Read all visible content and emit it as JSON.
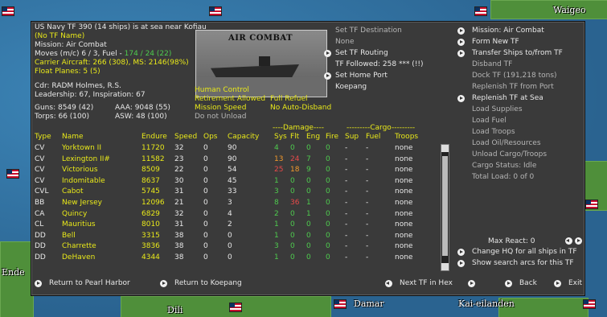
{
  "map": {
    "labels": [
      "Waigeo",
      "Dili",
      "Damar",
      "Kai-eilanden",
      "Ende"
    ]
  },
  "summary": {
    "title": "US Navy TF 390 (14 ships) is at sea near Kofiau",
    "tf_name": "(No TF Name)",
    "mission": "Mission: Air Combat",
    "moves_prefix": "Moves (m/c) 6 / 3, Fuel - ",
    "fuel": "174 / 24 (22)",
    "carrier": "Carrier Aircraft: 266 (308), MS: 2146(98%)",
    "float": "Float Planes: 5 (5)",
    "cdr": "Cdr: RADM Holmes, R.S.",
    "leadership": "Leadership: 67, Inspiration: 67",
    "guns": "Guns: 8549 (42)",
    "aaa": "AAA: 9048 (55)",
    "torps": "Torps: 66 (100)",
    "asw": "ASW: 48 (100)"
  },
  "photo_caption": "AIR COMBAT",
  "orders": {
    "human": "Human Control",
    "retire": "Retirement Allowed",
    "refuel": "Full Refuel",
    "speed": "Mission Speed",
    "disband": "No Auto-Disband",
    "unload": "Do not Unload"
  },
  "dest": {
    "set_dest": "Set TF Destination",
    "none": "None",
    "routing": "Set TF Routing",
    "followed": "TF Followed: 258 *** (!!)",
    "home": "Set Home Port",
    "port": "Koepang"
  },
  "menu": {
    "mission": "Mission: Air Combat",
    "form": "Form New TF",
    "transfer": "Transfer Ships to/from TF",
    "disband": "Disband TF",
    "dock": "Dock TF (191,218 tons)",
    "replenish_port": "Replenish TF from Port",
    "replenish_sea": "Replenish TF at Sea",
    "load_supplies": "Load Supplies",
    "load_fuel": "Load Fuel",
    "load_troops": "Load Troops",
    "load_oil": "Load Oil/Resources",
    "unload": "Unload Cargo/Troops",
    "cargo_status": "Cargo Status: Idle",
    "total_load": "Total Load: 0 of 0",
    "max_react": "Max React: 0",
    "change_hq": "Change HQ for all ships in TF",
    "search_arcs": "Show search arcs for this TF"
  },
  "table": {
    "damage_header": "----Damage----",
    "cargo_header": "---------Cargo---------",
    "columns": [
      "Type",
      "Name",
      "Endure",
      "Speed",
      "Ops",
      "Capacity",
      "Sys",
      "Flt",
      "Eng",
      "Fire",
      "Sup",
      "Fuel",
      "Troops"
    ],
    "rows": [
      {
        "type": "CV",
        "name": "Yorktown II",
        "endure": "11720",
        "speed": "32",
        "ops": "0",
        "cap": "90",
        "sys": "4",
        "flt": "0",
        "eng": "0",
        "fire": "0",
        "sup": "-",
        "fuel": "-",
        "troops": "none",
        "color": "#4ecb4e"
      },
      {
        "type": "CV",
        "name": "Lexington II#",
        "endure": "11582",
        "speed": "23",
        "ops": "0",
        "cap": "90",
        "sys": "13",
        "flt": "24",
        "eng": "7",
        "fire": "0",
        "sup": "-",
        "fuel": "-",
        "troops": "none",
        "color": "#f39a2c"
      },
      {
        "type": "CV",
        "name": "Victorious",
        "endure": "8509",
        "speed": "22",
        "ops": "0",
        "cap": "54",
        "sys": "25",
        "flt": "18",
        "eng": "9",
        "fire": "0",
        "sup": "-",
        "fuel": "-",
        "troops": "none",
        "color": "#f39a2c"
      },
      {
        "type": "CV",
        "name": "Indomitable",
        "endure": "8637",
        "speed": "30",
        "ops": "0",
        "cap": "45",
        "sys": "1",
        "flt": "0",
        "eng": "0",
        "fire": "0",
        "sup": "-",
        "fuel": "-",
        "troops": "none",
        "color": "#4ecb4e"
      },
      {
        "type": "CVL",
        "name": "Cabot",
        "endure": "5745",
        "speed": "31",
        "ops": "0",
        "cap": "33",
        "sys": "3",
        "flt": "0",
        "eng": "0",
        "fire": "0",
        "sup": "-",
        "fuel": "-",
        "troops": "none",
        "color": "#4ecb4e"
      },
      {
        "type": "BB",
        "name": "New Jersey",
        "endure": "12096",
        "speed": "21",
        "ops": "0",
        "cap": "3",
        "sys": "8",
        "flt": "36",
        "eng": "1",
        "fire": "0",
        "sup": "-",
        "fuel": "-",
        "troops": "none",
        "color": "#4ecb4e"
      },
      {
        "type": "CA",
        "name": "Quincy",
        "endure": "6829",
        "speed": "32",
        "ops": "0",
        "cap": "4",
        "sys": "2",
        "flt": "0",
        "eng": "1",
        "fire": "0",
        "sup": "-",
        "fuel": "-",
        "troops": "none",
        "color": "#4ecb4e"
      },
      {
        "type": "CL",
        "name": "Mauritius",
        "endure": "8010",
        "speed": "31",
        "ops": "0",
        "cap": "2",
        "sys": "1",
        "flt": "0",
        "eng": "0",
        "fire": "0",
        "sup": "-",
        "fuel": "-",
        "troops": "none",
        "color": "#4ecb4e"
      },
      {
        "type": "DD",
        "name": "Bell",
        "endure": "3315",
        "speed": "38",
        "ops": "0",
        "cap": "0",
        "sys": "1",
        "flt": "0",
        "eng": "0",
        "fire": "0",
        "sup": "-",
        "fuel": "-",
        "troops": "none",
        "color": "#4ecb4e"
      },
      {
        "type": "DD",
        "name": "Charrette",
        "endure": "3836",
        "speed": "38",
        "ops": "0",
        "cap": "0",
        "sys": "3",
        "flt": "0",
        "eng": "0",
        "fire": "0",
        "sup": "-",
        "fuel": "-",
        "troops": "none",
        "color": "#4ecb4e"
      },
      {
        "type": "DD",
        "name": "DeHaven",
        "endure": "4344",
        "speed": "38",
        "ops": "0",
        "cap": "0",
        "sys": "1",
        "flt": "0",
        "eng": "0",
        "fire": "0",
        "sup": "-",
        "fuel": "-",
        "troops": "none",
        "color": "#4ecb4e"
      }
    ]
  },
  "bottom": {
    "pearl": "Return to Pearl Harbor",
    "koepang": "Return to Koepang",
    "next_tf": "Next TF in Hex",
    "back": "Back",
    "exit": "Exit"
  }
}
